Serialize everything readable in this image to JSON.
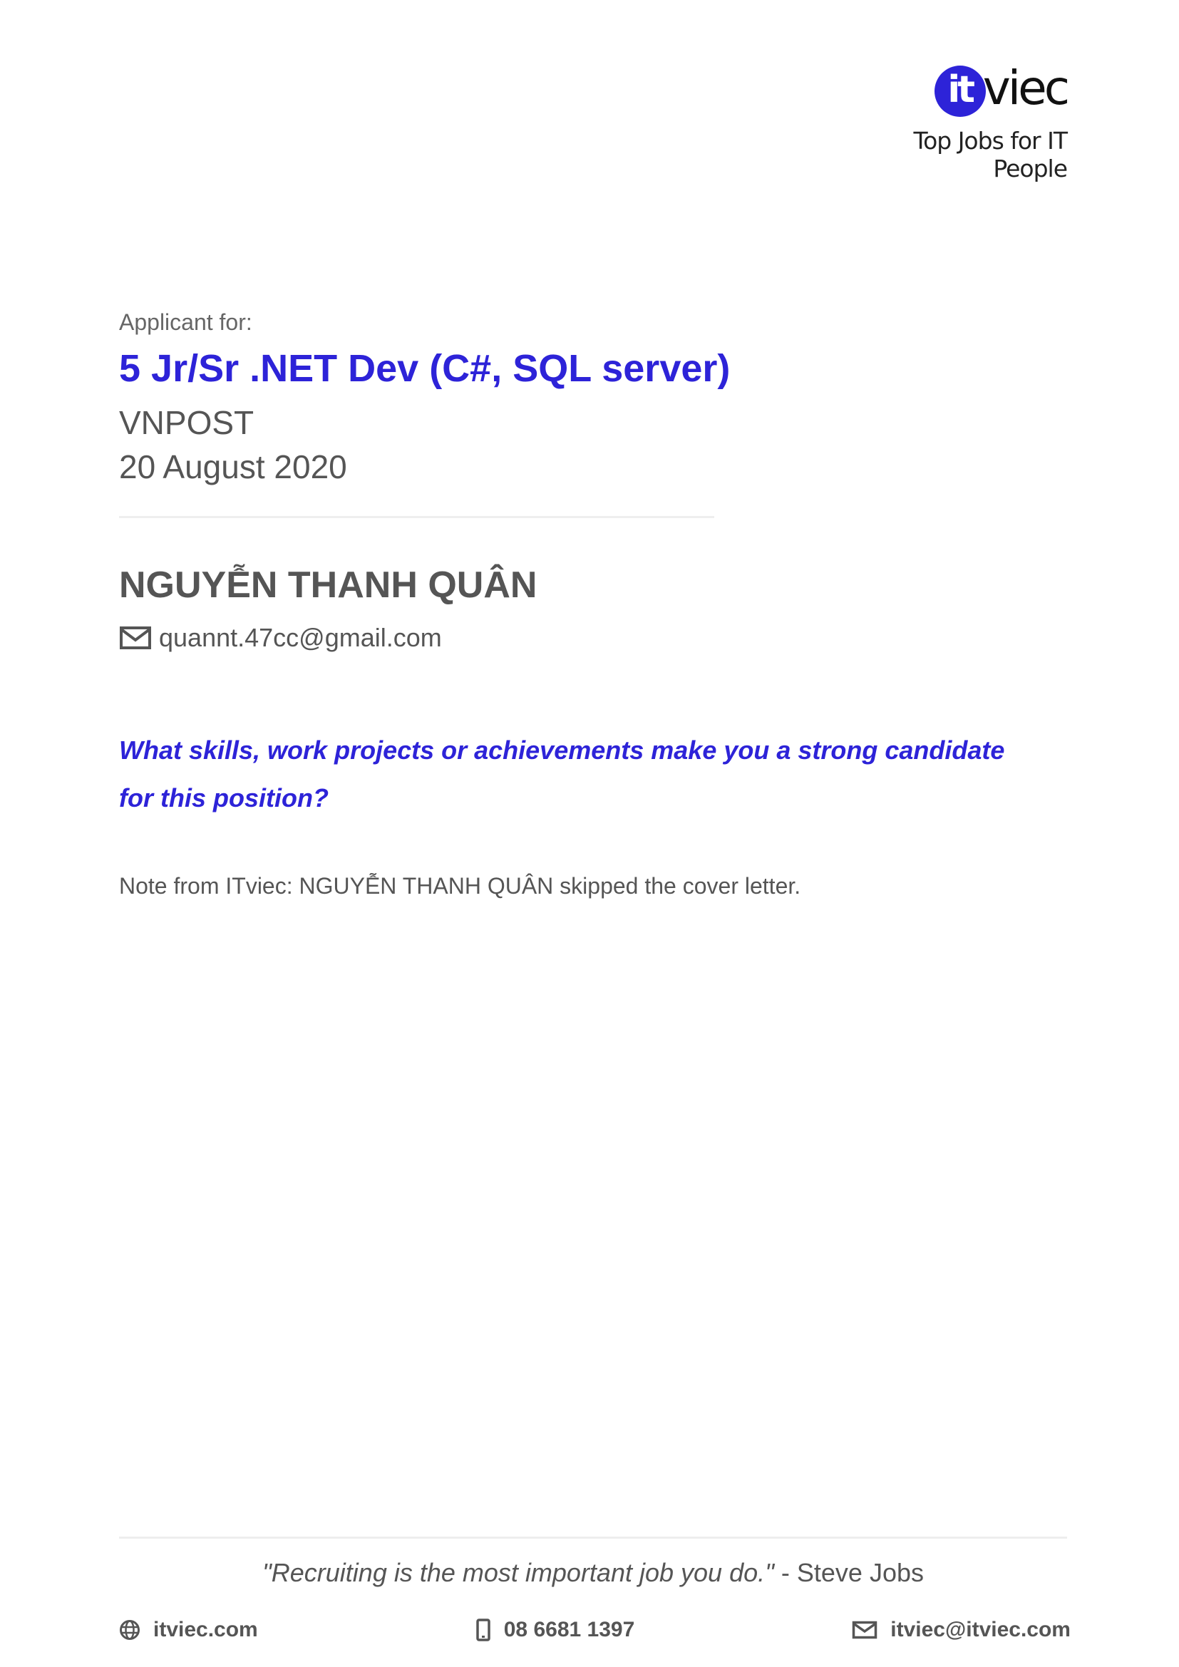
{
  "header": {
    "logo_mark": "it",
    "logo_text": "viec",
    "tagline": "Top Jobs for IT People"
  },
  "application": {
    "label": "Applicant for:",
    "job_title": "5 Jr/Sr .NET Dev (C#, SQL server)",
    "company": "VNPOST",
    "date": "20 August 2020"
  },
  "candidate": {
    "name": "NGUYỄN THANH QUÂN",
    "email": "quannt.47cc@gmail.com"
  },
  "question": "What skills, work projects or achievements make you a strong candidate for this position?",
  "note": "Note from ITviec: NGUYỄN THANH QUÂN skipped the cover letter.",
  "footer": {
    "quote": "\"Recruiting is the most important job you do.\"",
    "quote_author": " - Steve Jobs",
    "website": "itviec.com",
    "phone": "08 6681 1397",
    "email": "itviec@itviec.com"
  },
  "colors": {
    "brand_blue": "#2d23d8",
    "text_gray": "#555555"
  },
  "icons": {
    "email": "mail-icon",
    "website": "globe-icon",
    "phone": "phone-icon"
  }
}
